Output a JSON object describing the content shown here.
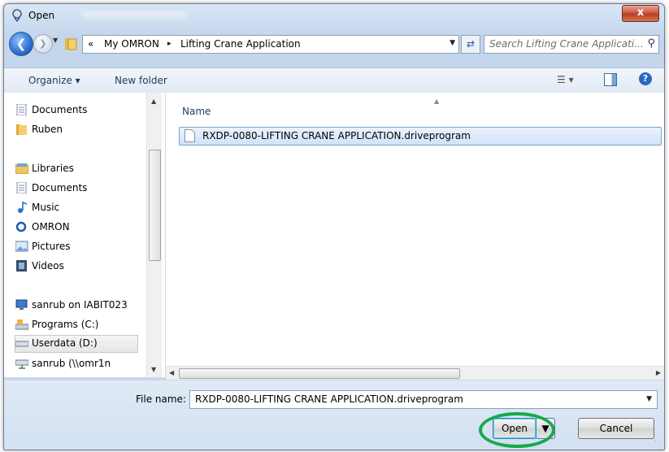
{
  "window": {
    "title": "Open",
    "close_label": "x"
  },
  "address": {
    "overflow": "«",
    "segments": [
      "My OMRON",
      "Lifting Crane Application"
    ],
    "separator": "▸",
    "search_placeholder": "Search Lifting Crane Applicati..."
  },
  "toolbar": {
    "organize_label": "Organize ▾",
    "new_folder_label": "New folder"
  },
  "nav_pane": {
    "items": [
      {
        "label": "Documents",
        "icon": "document-icon"
      },
      {
        "label": "Ruben",
        "icon": "folder-icon"
      },
      {
        "label": "Libraries",
        "icon": "libraries-icon"
      },
      {
        "label": "Documents",
        "icon": "document-icon"
      },
      {
        "label": "Music",
        "icon": "music-icon"
      },
      {
        "label": "OMRON",
        "icon": "omron-icon"
      },
      {
        "label": "Pictures",
        "icon": "pictures-icon"
      },
      {
        "label": "Videos",
        "icon": "videos-icon"
      },
      {
        "label": "sanrub on IABIT023",
        "icon": "computer-icon"
      },
      {
        "label": "Programs (C:)",
        "icon": "drive-icon"
      },
      {
        "label": "Userdata (D:)",
        "icon": "drive-icon"
      },
      {
        "label": "sanrub (\\\\omr1n",
        "icon": "network-drive-icon"
      }
    ]
  },
  "file_list": {
    "column_name": "Name",
    "files": [
      {
        "name": "RXDP-0080-LIFTING CRANE APPLICATION.driveprogram"
      }
    ]
  },
  "footer": {
    "file_name_label": "File name:",
    "file_name_value": "RXDP-0080-LIFTING CRANE APPLICATION.driveprogram",
    "open_label": "Open",
    "cancel_label": "Cancel"
  },
  "colors": {
    "highlight_ring": "#18a94b",
    "selection": "#d1e3fa",
    "accent": "#2c6fd1"
  }
}
